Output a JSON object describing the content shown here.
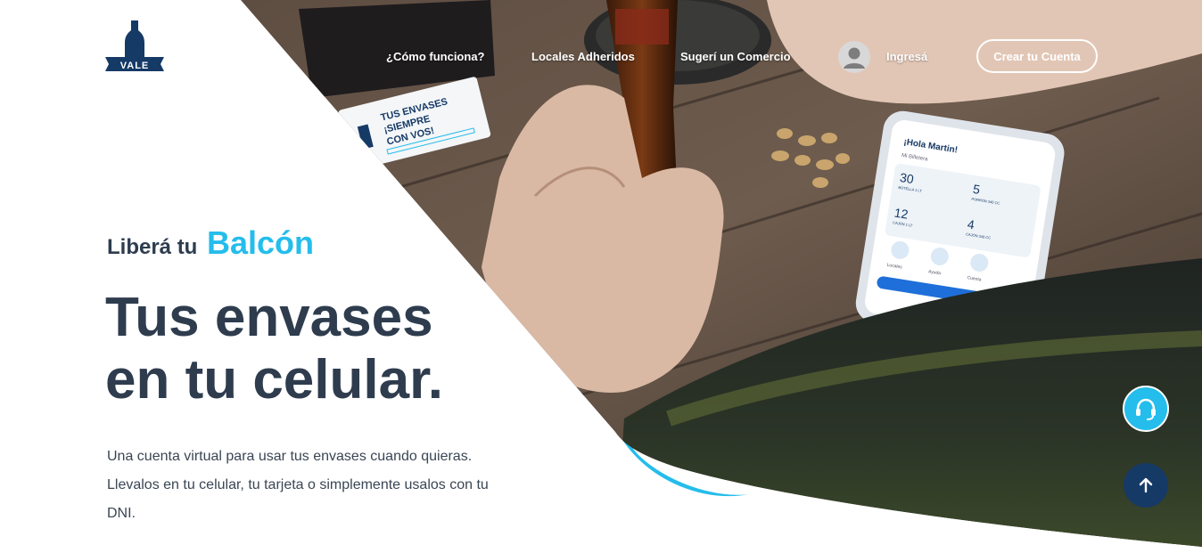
{
  "brand": {
    "logo_text": "VALE",
    "colors": {
      "navy": "#163a66",
      "accent": "#24bdec",
      "ink": "#2e3c4e"
    }
  },
  "nav": {
    "items": [
      {
        "label": "¿Cómo funciona?"
      },
      {
        "label": "Locales Adheridos"
      },
      {
        "label": "Sugerí un Comercio"
      }
    ],
    "login_label": "Ingresá",
    "signup_label": "Crear tu Cuenta",
    "avatar_icon": "user-icon"
  },
  "hero": {
    "eyebrow_prefix": "Liberá tu",
    "eyebrow_accent": "Balcón",
    "headline_line1": "Tus envases",
    "headline_line2": "en tu celular.",
    "description": "Una cuenta virtual para usar tus envases cuando quieras. Llevalos en tu celular, tu tarjeta o simplemente usalos con tu DNI."
  },
  "photo": {
    "card_text_line1": "TUS ENVASES",
    "card_text_line2": "¡SIEMPRE",
    "card_text_line3": "CON VOS!",
    "phone": {
      "greeting": "¡Hola Martin!",
      "wallet_label": "Mi Billetera",
      "stats": [
        {
          "value": "30",
          "label": "BOTELLA 1 LT"
        },
        {
          "value": "5",
          "label": "PORRÓN 340 CC"
        },
        {
          "value": "12",
          "label": "CAJÓN 1 LT"
        },
        {
          "value": "4",
          "label": "CAJÓN 340 CC"
        }
      ],
      "menu": [
        "Locales",
        "Ayuda",
        "Cuenta"
      ]
    }
  },
  "floating": {
    "support_icon": "headset-icon",
    "top_icon": "arrow-up-icon"
  }
}
